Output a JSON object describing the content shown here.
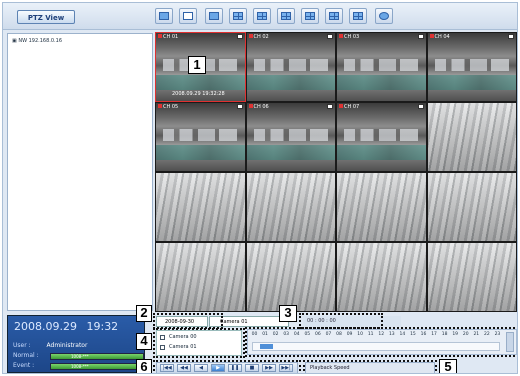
{
  "toolbar": {
    "ptz_label": "PTZ View",
    "buttons": [
      "screenshot-icon",
      "close-layout-icon",
      "layout-1-icon",
      "layout-4-icon",
      "layout-9-icon",
      "layout-16-icon",
      "layout-6-icon",
      "layout-8-icon",
      "layout-13-icon",
      "settings-icon"
    ]
  },
  "tree": {
    "node_label": "NW 192.168.0.16"
  },
  "grid": {
    "tiles": [
      {
        "label": "CH 01",
        "stamp": "2008.09.29  19:32:28"
      },
      {
        "label": "CH 02"
      },
      {
        "label": "CH 03"
      },
      {
        "label": "CH 04"
      },
      {
        "label": "CH 05"
      },
      {
        "label": "CH 06"
      },
      {
        "label": "CH 07"
      },
      {
        "label": ""
      },
      {
        "label": ""
      },
      {
        "label": ""
      },
      {
        "label": ""
      },
      {
        "label": ""
      },
      {
        "label": ""
      },
      {
        "label": ""
      },
      {
        "label": ""
      },
      {
        "label": ""
      }
    ]
  },
  "callouts": {
    "c1": "1",
    "c2": "2",
    "c3": "3",
    "c4": "4",
    "c5": "5",
    "c6": "6"
  },
  "info": {
    "date": "2008.09.29",
    "time": "19:32",
    "user_label": "User :",
    "user_value": "Administrator",
    "normal_label": "Normal :",
    "normal_value": "1008-***",
    "event_label": "Event :",
    "event_value": "1008-***"
  },
  "search": {
    "date": "2008-09-30",
    "camera": "Camera 01",
    "time": "00 : 00 : 00"
  },
  "camera_list": {
    "items": [
      "Camera 00",
      "Camera 01"
    ]
  },
  "timeline": {
    "hours": [
      "00",
      "01",
      "02",
      "03",
      "04",
      "05",
      "06",
      "07",
      "08",
      "09",
      "10",
      "11",
      "12",
      "13",
      "14",
      "15",
      "16",
      "17",
      "18",
      "19",
      "20",
      "21",
      "22",
      "23"
    ],
    "recording": [
      {
        "start": 0.03,
        "end": 0.08
      }
    ]
  },
  "playback": {
    "buttons": [
      "|◀◀",
      "◀◀",
      "◀",
      "▶",
      "❚❚",
      "■",
      "▶▶",
      "▶▶|"
    ],
    "speed_label": "Playback Speed"
  }
}
